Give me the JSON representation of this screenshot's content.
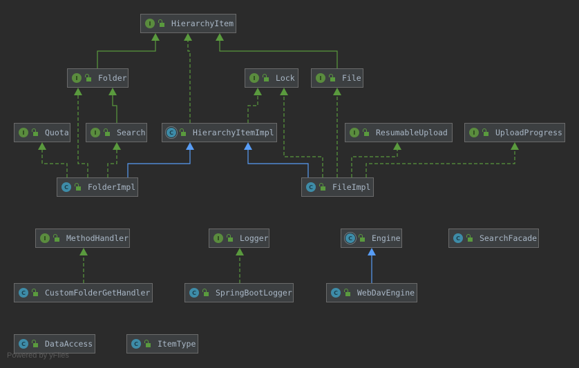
{
  "diagram": {
    "watermark": "Powered by yFiles",
    "colors": {
      "background": "#2b2b2b",
      "implements_edge": "#5a9a3e",
      "extends_interface_edge": "#5a9a3e",
      "extends_class_edge": "#589df6",
      "node_fill": "#3c3f41",
      "node_border": "#6b6b6b",
      "node_text": "#a9b7c6"
    },
    "nodes": [
      {
        "id": "HierarchyItem",
        "label": "HierarchyItem",
        "kind": "interface",
        "kind_glyph": "I"
      },
      {
        "id": "Folder",
        "label": "Folder",
        "kind": "interface",
        "kind_glyph": "I"
      },
      {
        "id": "Lock",
        "label": "Lock",
        "kind": "interface",
        "kind_glyph": "I"
      },
      {
        "id": "File",
        "label": "File",
        "kind": "interface",
        "kind_glyph": "I"
      },
      {
        "id": "Quota",
        "label": "Quota",
        "kind": "interface",
        "kind_glyph": "I"
      },
      {
        "id": "Search",
        "label": "Search",
        "kind": "interface",
        "kind_glyph": "I"
      },
      {
        "id": "HierarchyItemImpl",
        "label": "HierarchyItemImpl",
        "kind": "abstract",
        "kind_glyph": "C"
      },
      {
        "id": "ResumableUpload",
        "label": "ResumableUpload",
        "kind": "interface",
        "kind_glyph": "I"
      },
      {
        "id": "UploadProgress",
        "label": "UploadProgress",
        "kind": "interface",
        "kind_glyph": "I"
      },
      {
        "id": "FolderImpl",
        "label": "FolderImpl",
        "kind": "class",
        "kind_glyph": "C"
      },
      {
        "id": "FileImpl",
        "label": "FileImpl",
        "kind": "class",
        "kind_glyph": "C"
      },
      {
        "id": "MethodHandler",
        "label": "MethodHandler",
        "kind": "interface",
        "kind_glyph": "I"
      },
      {
        "id": "Logger",
        "label": "Logger",
        "kind": "interface",
        "kind_glyph": "I"
      },
      {
        "id": "Engine",
        "label": "Engine",
        "kind": "abstract",
        "kind_glyph": "C"
      },
      {
        "id": "SearchFacade",
        "label": "SearchFacade",
        "kind": "class",
        "kind_glyph": "C"
      },
      {
        "id": "CustomFolderGetHandler",
        "label": "CustomFolderGetHandler",
        "kind": "class",
        "kind_glyph": "C"
      },
      {
        "id": "SpringBootLogger",
        "label": "SpringBootLogger",
        "kind": "class",
        "kind_glyph": "C"
      },
      {
        "id": "WebDavEngine",
        "label": "WebDavEngine",
        "kind": "class",
        "kind_glyph": "C"
      },
      {
        "id": "DataAccess",
        "label": "DataAccess",
        "kind": "class",
        "kind_glyph": "C"
      },
      {
        "id": "ItemType",
        "label": "ItemType",
        "kind": "class",
        "kind_glyph": "C"
      }
    ],
    "edges": [
      {
        "from": "Folder",
        "to": "HierarchyItem",
        "type": "extends-interface"
      },
      {
        "from": "HierarchyItemImpl",
        "to": "HierarchyItem",
        "type": "implements"
      },
      {
        "from": "File",
        "to": "HierarchyItem",
        "type": "extends-interface"
      },
      {
        "from": "Search",
        "to": "Folder",
        "type": "extends-interface"
      },
      {
        "from": "HierarchyItemImpl",
        "to": "Lock",
        "type": "implements"
      },
      {
        "from": "FolderImpl",
        "to": "Quota",
        "type": "implements"
      },
      {
        "from": "FolderImpl",
        "to": "Folder",
        "type": "implements"
      },
      {
        "from": "FolderImpl",
        "to": "Search",
        "type": "implements"
      },
      {
        "from": "FolderImpl",
        "to": "HierarchyItemImpl",
        "type": "extends-class"
      },
      {
        "from": "FileImpl",
        "to": "HierarchyItemImpl",
        "type": "extends-class"
      },
      {
        "from": "FileImpl",
        "to": "Lock",
        "type": "implements"
      },
      {
        "from": "FileImpl",
        "to": "File",
        "type": "implements"
      },
      {
        "from": "FileImpl",
        "to": "ResumableUpload",
        "type": "implements"
      },
      {
        "from": "FileImpl",
        "to": "UploadProgress",
        "type": "implements"
      },
      {
        "from": "CustomFolderGetHandler",
        "to": "MethodHandler",
        "type": "implements"
      },
      {
        "from": "SpringBootLogger",
        "to": "Logger",
        "type": "implements"
      },
      {
        "from": "WebDavEngine",
        "to": "Engine",
        "type": "extends-class"
      }
    ]
  }
}
